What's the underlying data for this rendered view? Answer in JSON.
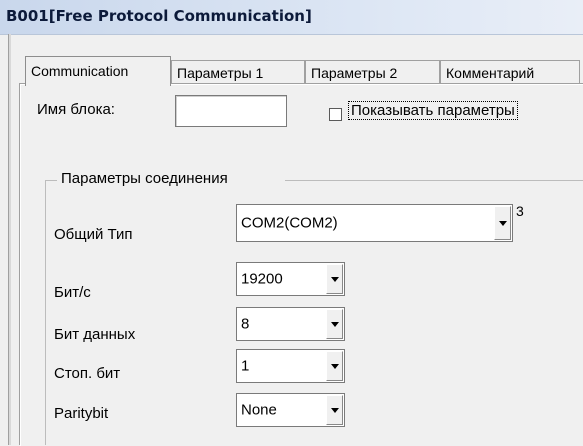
{
  "window": {
    "title": "B001[Free Protocol Communication]"
  },
  "tabs": [
    {
      "label": "Communication",
      "active": true
    },
    {
      "label": "Параметры 1",
      "active": false
    },
    {
      "label": "Параметры 2",
      "active": false
    },
    {
      "label": "Комментарий",
      "active": false
    }
  ],
  "block_name": {
    "label": "Имя блока:",
    "value": ""
  },
  "show_params": {
    "label": "Показывать параметры",
    "checked": false
  },
  "connection": {
    "group_label": "Параметры соединения",
    "general_type": {
      "label": "Общий  Тип",
      "value": "COM2(COM2)",
      "suffix": "3"
    },
    "baud": {
      "label": "Бит/с",
      "value": "19200"
    },
    "data_bits": {
      "label": "Бит данных",
      "value": "8"
    },
    "stop_bits": {
      "label": "Стоп. бит",
      "value": "1"
    },
    "parity": {
      "label": "Paritybit",
      "value": "None"
    }
  }
}
